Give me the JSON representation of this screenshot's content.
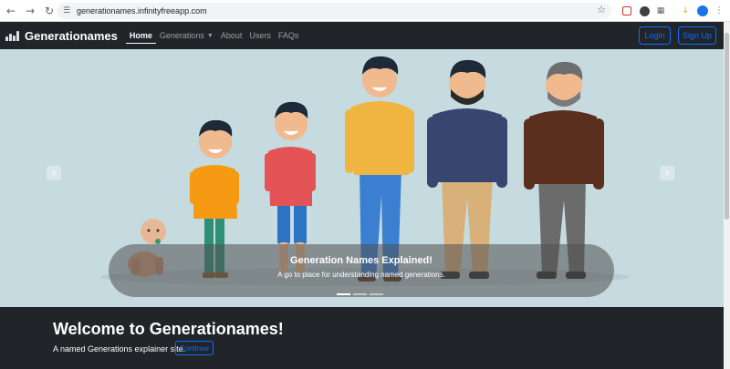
{
  "browser": {
    "url": "generationames.infinityfreeapp.com",
    "icons": {
      "back": "back-arrow-icon",
      "forward": "forward-arrow-icon",
      "reload": "reload-icon",
      "site_settings": "tune-icon",
      "bookmark": "star-icon"
    }
  },
  "navbar": {
    "brand": "Generationames",
    "links": [
      {
        "label": "Home"
      },
      {
        "label": "Generations"
      },
      {
        "label": "About"
      },
      {
        "label": "Users"
      },
      {
        "label": "FAQs"
      }
    ],
    "login_label": "Login",
    "signup_label": "Sign Up",
    "accent_color": "#0d6efd"
  },
  "carousel": {
    "caption_title": "Generation Names Explained!",
    "caption_text": "A go to place for understanding named generations.",
    "slide_count": 3,
    "active_slide": 1,
    "background_color": "#c6dbe0"
  },
  "welcome": {
    "title": "Welcome to Generationames!",
    "subtitle": "A named Generations explainer site.",
    "continue_label": "Continue"
  }
}
